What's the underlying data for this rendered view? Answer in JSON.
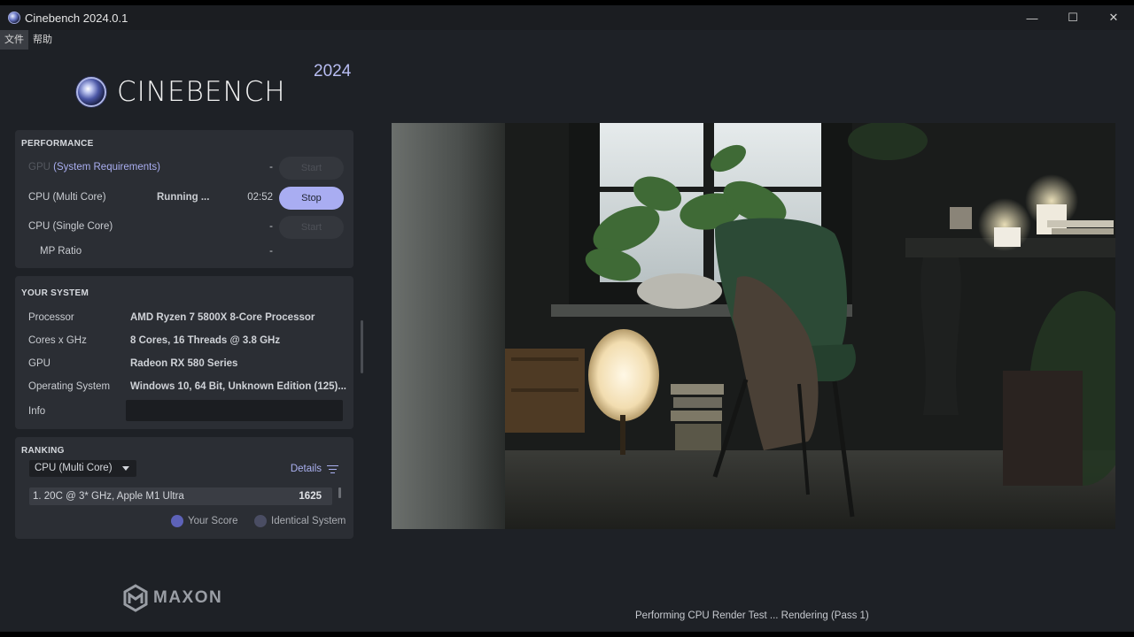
{
  "window": {
    "title": "Cinebench 2024.0.1",
    "controls": {
      "minimize": "—",
      "maximize": "☐",
      "close": "✕"
    }
  },
  "menu": [
    {
      "label": "文件"
    },
    {
      "label": "帮助"
    }
  ],
  "logo": {
    "text": "CINEBENCH",
    "year": "2024"
  },
  "performance": {
    "title": "PERFORMANCE",
    "gpu": {
      "label_dim": "GPU",
      "label_link": "(System Requirements)",
      "value": "-",
      "button": "Start"
    },
    "cpu_multi": {
      "label": "CPU (Multi Core)",
      "status": "Running ...",
      "value": "02:52",
      "button": "Stop"
    },
    "cpu_single": {
      "label": "CPU (Single Core)",
      "value": "-",
      "button": "Start"
    },
    "mp_ratio": {
      "label": "MP Ratio",
      "value": "-"
    }
  },
  "system": {
    "title": "YOUR SYSTEM",
    "rows": [
      {
        "key": "Processor",
        "value": "AMD Ryzen 7 5800X 8-Core Processor"
      },
      {
        "key": "Cores x GHz",
        "value": "8 Cores, 16 Threads @ 3.8 GHz"
      },
      {
        "key": "GPU",
        "value": "Radeon RX 580 Series"
      },
      {
        "key": "Operating System",
        "value": "Windows 10, 64 Bit, Unknown Edition (125)..."
      },
      {
        "key": "Info",
        "value": ""
      }
    ]
  },
  "ranking": {
    "title": "RANKING",
    "selected": "CPU (Multi Core)",
    "details": "Details",
    "entries": [
      {
        "name": "1. 20C @ 3* GHz, Apple M1 Ultra",
        "score": "1625"
      }
    ],
    "legend": {
      "your": "Your Score",
      "identical": "Identical System"
    }
  },
  "brand": {
    "maxon": "MAXON"
  },
  "status": "Performing CPU Render Test ... Rendering (Pass 1)",
  "colors": {
    "accent": "#a9adf2",
    "background": "#1e2126",
    "panel": "#2b2e34"
  }
}
